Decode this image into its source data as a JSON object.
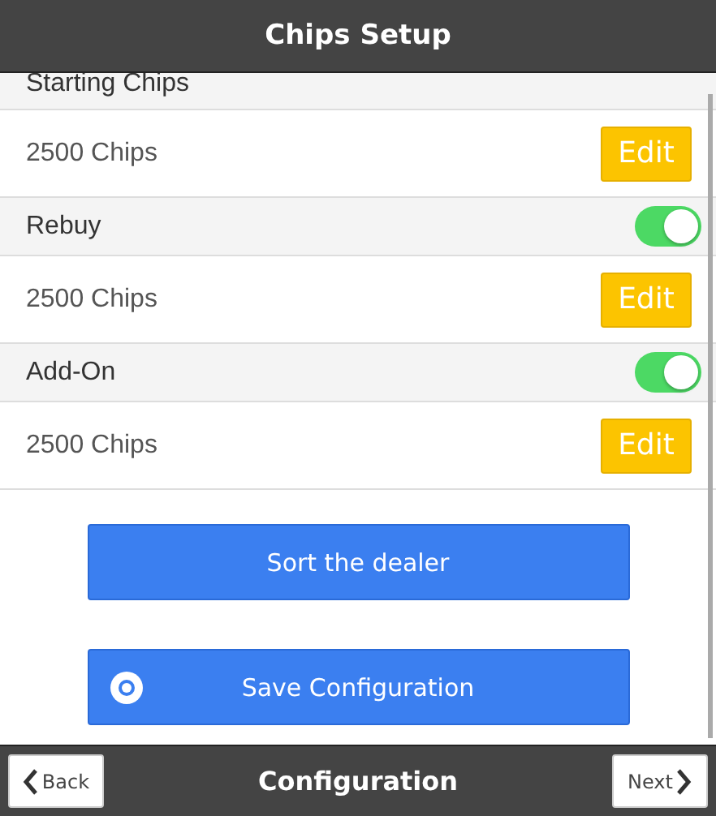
{
  "header": {
    "title": "Chips Setup"
  },
  "sections": [
    {
      "label": "Starting Chips",
      "value": "2500 Chips",
      "action": "Edit"
    },
    {
      "label": "Rebuy",
      "on": true,
      "value": "2500 Chips",
      "action": "Edit"
    },
    {
      "label": "Add-On",
      "on": true,
      "value": "2500 Chips",
      "action": "Edit"
    }
  ],
  "buttons": [
    {
      "kind": "plain",
      "label": "Sort the dealer"
    },
    {
      "kind": "icon",
      "label": "Save Configuration"
    }
  ],
  "footer": {
    "back": "Back",
    "title": "Configuration",
    "next": "Next"
  }
}
